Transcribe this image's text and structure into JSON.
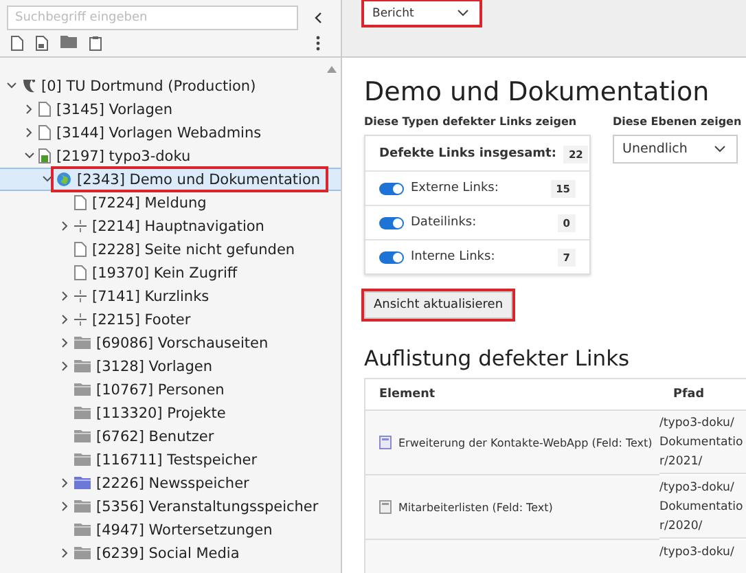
{
  "sidebar": {
    "search": {
      "placeholder": "Suchbegriff eingeben"
    },
    "tree": [
      {
        "label": "[0] TU Dortmund (Production)",
        "kind": "site",
        "expandable": true,
        "expanded": true,
        "selected": false,
        "highlighted": false,
        "children": [
          {
            "label": "[3145] Vorlagen",
            "kind": "page",
            "expandable": true,
            "expanded": false,
            "selected": false,
            "highlighted": false
          },
          {
            "label": "[3144] Vorlagen Webadmins",
            "kind": "page",
            "expandable": true,
            "expanded": false,
            "selected": false,
            "highlighted": false
          },
          {
            "label": "[2197] typo3-doku",
            "kind": "page-green",
            "expandable": true,
            "expanded": true,
            "selected": false,
            "highlighted": false,
            "children": [
              {
                "label": "[2343] Demo und Dokumentation",
                "kind": "globe",
                "expandable": true,
                "expanded": true,
                "selected": true,
                "highlighted": true,
                "children": [
                  {
                    "label": "[7224] Meldung",
                    "kind": "page",
                    "expandable": false,
                    "expanded": false,
                    "selected": false,
                    "highlighted": false
                  },
                  {
                    "label": "[2214] Hauptnavigation",
                    "kind": "separator",
                    "expandable": true,
                    "expanded": false,
                    "selected": false,
                    "highlighted": false
                  },
                  {
                    "label": "[2228] Seite nicht gefunden",
                    "kind": "page",
                    "expandable": false,
                    "expanded": false,
                    "selected": false,
                    "highlighted": false
                  },
                  {
                    "label": "[19370] Kein Zugriff",
                    "kind": "page",
                    "expandable": false,
                    "expanded": false,
                    "selected": false,
                    "highlighted": false
                  },
                  {
                    "label": "[7141] Kurzlinks",
                    "kind": "separator",
                    "expandable": true,
                    "expanded": false,
                    "selected": false,
                    "highlighted": false
                  },
                  {
                    "label": "[2215] Footer",
                    "kind": "separator",
                    "expandable": true,
                    "expanded": false,
                    "selected": false,
                    "highlighted": false
                  },
                  {
                    "label": "[69086] Vorschauseiten",
                    "kind": "folder",
                    "expandable": true,
                    "expanded": false,
                    "selected": false,
                    "highlighted": false
                  },
                  {
                    "label": "[3128] Vorlagen",
                    "kind": "folder",
                    "expandable": true,
                    "expanded": false,
                    "selected": false,
                    "highlighted": false
                  },
                  {
                    "label": "[10767] Personen",
                    "kind": "folder",
                    "expandable": false,
                    "expanded": false,
                    "selected": false,
                    "highlighted": false
                  },
                  {
                    "label": "[113320] Projekte",
                    "kind": "folder",
                    "expandable": false,
                    "expanded": false,
                    "selected": false,
                    "highlighted": false
                  },
                  {
                    "label": "[6762] Benutzer",
                    "kind": "folder",
                    "expandable": false,
                    "expanded": false,
                    "selected": false,
                    "highlighted": false
                  },
                  {
                    "label": "[116711] Testspeicher",
                    "kind": "folder",
                    "expandable": false,
                    "expanded": false,
                    "selected": false,
                    "highlighted": false
                  },
                  {
                    "label": "[2226] Newsspeicher",
                    "kind": "folder-blue",
                    "expandable": true,
                    "expanded": false,
                    "selected": false,
                    "highlighted": false
                  },
                  {
                    "label": "[5356] Veranstaltungsspeicher",
                    "kind": "folder",
                    "expandable": true,
                    "expanded": false,
                    "selected": false,
                    "highlighted": false
                  },
                  {
                    "label": "[4947] Wortersetzungen",
                    "kind": "folder",
                    "expandable": false,
                    "expanded": false,
                    "selected": false,
                    "highlighted": false
                  },
                  {
                    "label": "[6239] Social Media",
                    "kind": "folder",
                    "expandable": true,
                    "expanded": false,
                    "selected": false,
                    "highlighted": false
                  }
                ]
              }
            ]
          }
        ]
      }
    ]
  },
  "toolbar": {
    "view_select": {
      "value": "Bericht",
      "highlighted": true
    }
  },
  "content": {
    "title": "Demo und Dokumentation",
    "types_label": "Diese Typen defekter Links zeigen",
    "levels_label": "Diese Ebenen zeigen",
    "levels_select": {
      "value": "Unendlich"
    },
    "summary": {
      "label": "Defekte Links insgesamt:",
      "count": "22"
    },
    "link_types": [
      {
        "label": "Externe Links:",
        "count": "15",
        "on": true
      },
      {
        "label": "Dateilinks:",
        "count": "0",
        "on": true
      },
      {
        "label": "Interne Links:",
        "count": "7",
        "on": true
      }
    ],
    "refresh_button": {
      "label": "Ansicht aktualisieren",
      "highlighted": true
    },
    "list_title": "Auflistung defekter Links",
    "table": {
      "columns": [
        "Element",
        "Pfad"
      ],
      "rows": [
        {
          "kind": "text",
          "element": "Erweiterung der Kontakte-WebApp (Feld: Text)",
          "path": [
            "/typo3-doku/",
            "Dokumentatio",
            "r/2021/"
          ]
        },
        {
          "kind": "table",
          "element": "Mitarbeiterlisten (Feld: Text)",
          "path": [
            "/typo3-doku/",
            "Dokumentatio",
            "r/2020/"
          ]
        },
        {
          "kind": "cut",
          "path": [
            "/typo3-doku/"
          ]
        }
      ]
    }
  }
}
